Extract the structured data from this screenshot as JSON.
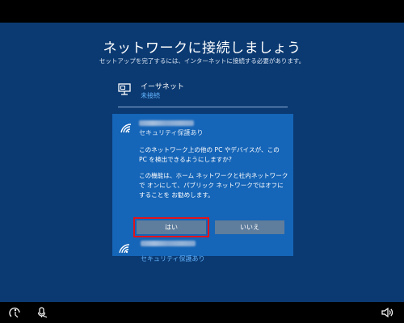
{
  "header": {
    "title": "ネットワークに接続しましょう",
    "subtitle": "セットアップを完了するには、インターネットに接続する必要があります。"
  },
  "networks": {
    "ethernet": {
      "name": "イーサネット",
      "status": "未接続",
      "icon": "ethernet-icon"
    },
    "wifi_selected": {
      "security": "セキュリティ保護あり",
      "icon": "wifi-icon",
      "question": "このネットワーク上の他の PC やデバイスが、この PC を検出できるようにしますか?",
      "explanation": "この機能は、ホーム ネットワークと社内ネットワークで オンにして、パブリック ネットワークではオフにすることを お勧めします。",
      "yes_label": "はい",
      "no_label": "いいえ"
    },
    "wifi_other": {
      "security": "セキュリティ保護あり",
      "icon": "wifi-icon"
    }
  },
  "taskbar": {
    "icons": [
      "ease-of-access-icon",
      "microphone-icon",
      "volume-icon"
    ]
  },
  "colors": {
    "background": "#0b3a72",
    "panel": "#1565b8",
    "accent_link": "#63b4ff",
    "button": "#5f7d9c",
    "highlight_outline": "#e0141b"
  }
}
